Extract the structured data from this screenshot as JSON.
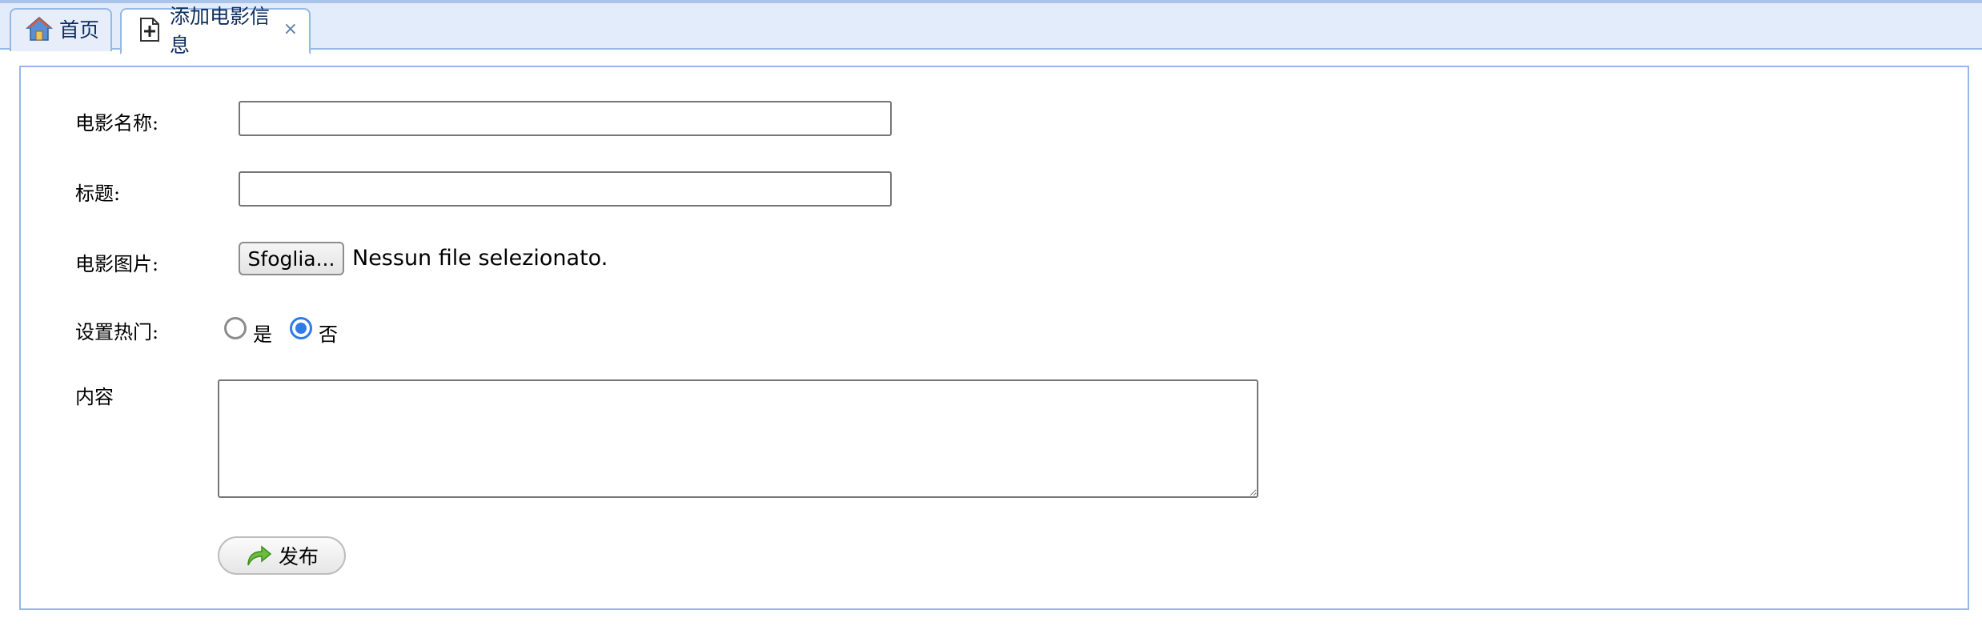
{
  "tabs": [
    {
      "label": "首页",
      "icon": "home-icon",
      "active": false
    },
    {
      "label": "添加电影信息",
      "icon": "add-document-icon",
      "active": true,
      "close": "×"
    }
  ],
  "form": {
    "movie_name": {
      "label": "电影名称:",
      "value": ""
    },
    "title": {
      "label": "标题:",
      "value": ""
    },
    "movie_image": {
      "label": "电影图片:",
      "button_label": "Sfoglia...",
      "status": "Nessun file selezionato."
    },
    "set_hot": {
      "label": "设置热门:",
      "options": [
        {
          "label": "是",
          "selected": false
        },
        {
          "label": "否",
          "selected": true
        }
      ]
    },
    "content": {
      "label": "内容",
      "value": ""
    },
    "submit": {
      "label": "发布",
      "icon": "redo-arrow-icon"
    }
  },
  "colors": {
    "tab_border": "#95b8e7",
    "tab_bar_bg": "#e3ecfb",
    "radio_accent": "#2f7be8",
    "submit_icon": "#6abf3a"
  }
}
